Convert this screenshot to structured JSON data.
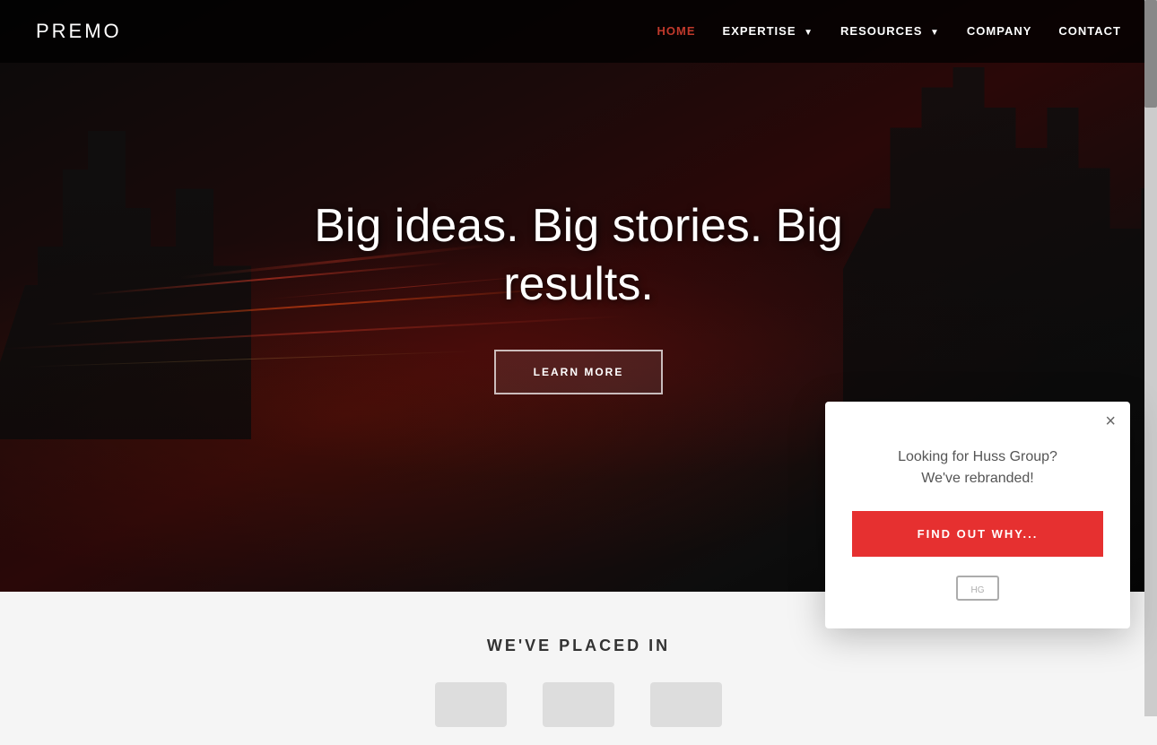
{
  "brand": {
    "logo": "PREMO"
  },
  "navbar": {
    "links": [
      {
        "label": "HOME",
        "active": true,
        "has_dropdown": false
      },
      {
        "label": "EXPERTISE",
        "active": false,
        "has_dropdown": true
      },
      {
        "label": "RESOURCES",
        "active": false,
        "has_dropdown": true
      },
      {
        "label": "COMPANY",
        "active": false,
        "has_dropdown": false
      },
      {
        "label": "CONTACT",
        "active": false,
        "has_dropdown": false
      }
    ]
  },
  "hero": {
    "title": "Big ideas. Big stories. Big results.",
    "cta_label": "LEARN MORE"
  },
  "below_hero": {
    "section_title": "WE'VE PLACED IN"
  },
  "modal": {
    "message_line1": "Looking for Huss Group?",
    "message_line2": "We've rebranded!",
    "cta_label": "FIND OUT WHY...",
    "close_label": "×"
  }
}
